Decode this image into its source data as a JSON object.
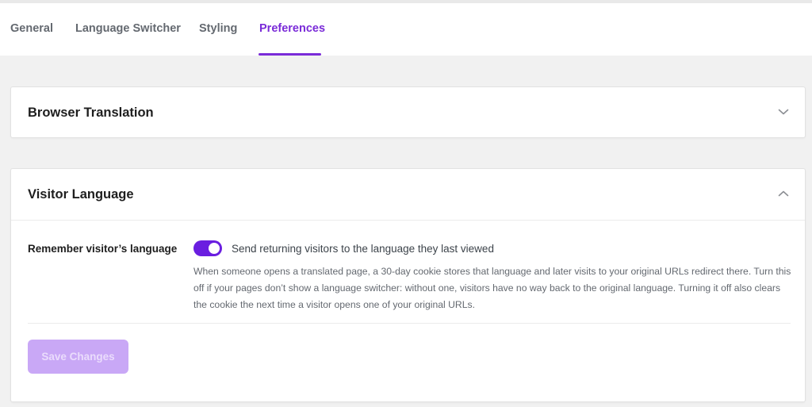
{
  "tabs": [
    {
      "label": "General",
      "active": false
    },
    {
      "label": "Language Switcher",
      "active": false
    },
    {
      "label": "Styling",
      "active": false
    },
    {
      "label": "Preferences",
      "active": true
    }
  ],
  "sections": {
    "browser_translation": {
      "title": "Browser Translation",
      "expanded": false,
      "toggle_icon": "chevron-down-icon"
    },
    "visitor_language": {
      "title": "Visitor Language",
      "expanded": true,
      "toggle_icon": "chevron-up-icon",
      "setting": {
        "label": "Remember visitor’s language",
        "toggle_on": true,
        "toggle_text": "Send returning visitors to the language they last viewed",
        "description": "When someone opens a translated page, a 30-day cookie stores that language and later visits to your original URLs redirect there. Turn this off if your pages don’t show a language switcher: without one, visitors have no way back to the original language. Turning it off also clears the cookie the next time a visitor opens one of your original URLs."
      },
      "save_label": "Save Changes",
      "save_disabled": true
    }
  },
  "colors": {
    "accent": "#7a2bd8",
    "toggle_on": "#6a1ee0",
    "save_disabled_bg": "#c9a8f6"
  }
}
